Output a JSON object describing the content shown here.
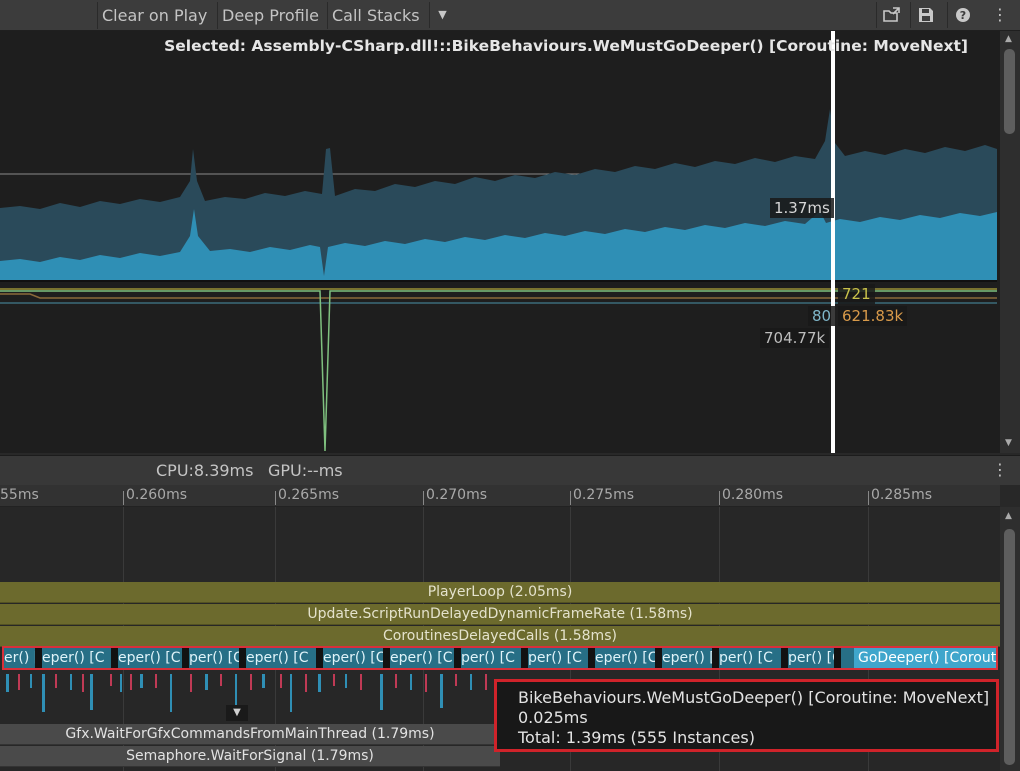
{
  "toolbar": {
    "clear_on_play": "Clear on Play",
    "deep_profile": "Deep Profile",
    "call_stacks": "Call Stacks",
    "icons": [
      "chevron-down-icon",
      "load-icon",
      "save-icon",
      "help-icon",
      "more-icon"
    ]
  },
  "graph": {
    "selected": "Selected: Assembly-CSharp.dll!::BikeBehaviours.WeMustGoDeeper() [Coroutine: MoveNext]",
    "cpu_tag": "1.37ms",
    "tag_721": "721",
    "tag_80": "80",
    "tag_621": "621.83k",
    "tag_704": "704.77k",
    "colors": {
      "cpu_fill": "#2f8fb5",
      "cpu_back": "#264c5e",
      "selection": "#ffffff"
    }
  },
  "stats": {
    "cpu": "CPU:8.39ms",
    "gpu": "GPU:--ms"
  },
  "ruler": {
    "ticks": [
      "55ms",
      "0.260ms",
      "0.265ms",
      "0.270ms",
      "0.275ms",
      "0.280ms",
      "0.285ms"
    ]
  },
  "timeline": {
    "player_loop": "PlayerLoop (2.05ms)",
    "update_script": "Update.ScriptRunDelayedDynamicFrameRate (1.58ms)",
    "coroutines_calls": "CoroutinesDelayedCalls (1.58ms)",
    "coroutine_segments": [
      "er() [C",
      "eper() [C",
      "eper() [C",
      "per() [C",
      "eper() [C",
      "eper() [C",
      "eper() [C",
      "per() [C",
      "per() [C",
      "eper() [C",
      "eper() [C",
      "per() [C"
    ],
    "coroutine_last": "GoDeeper() [Coroutine: MoveNext]",
    "gfx_wait": "Gfx.WaitForGfxCommandsFromMainThread (1.79ms)",
    "semaphore": "Semaphore.WaitForSignal (1.79ms)"
  },
  "tooltip": {
    "name": "BikeBehaviours.WeMustGoDeeper() [Coroutine: MoveNext]",
    "time": "0.025ms",
    "total": "Total: 1.39ms (555 Instances)"
  }
}
